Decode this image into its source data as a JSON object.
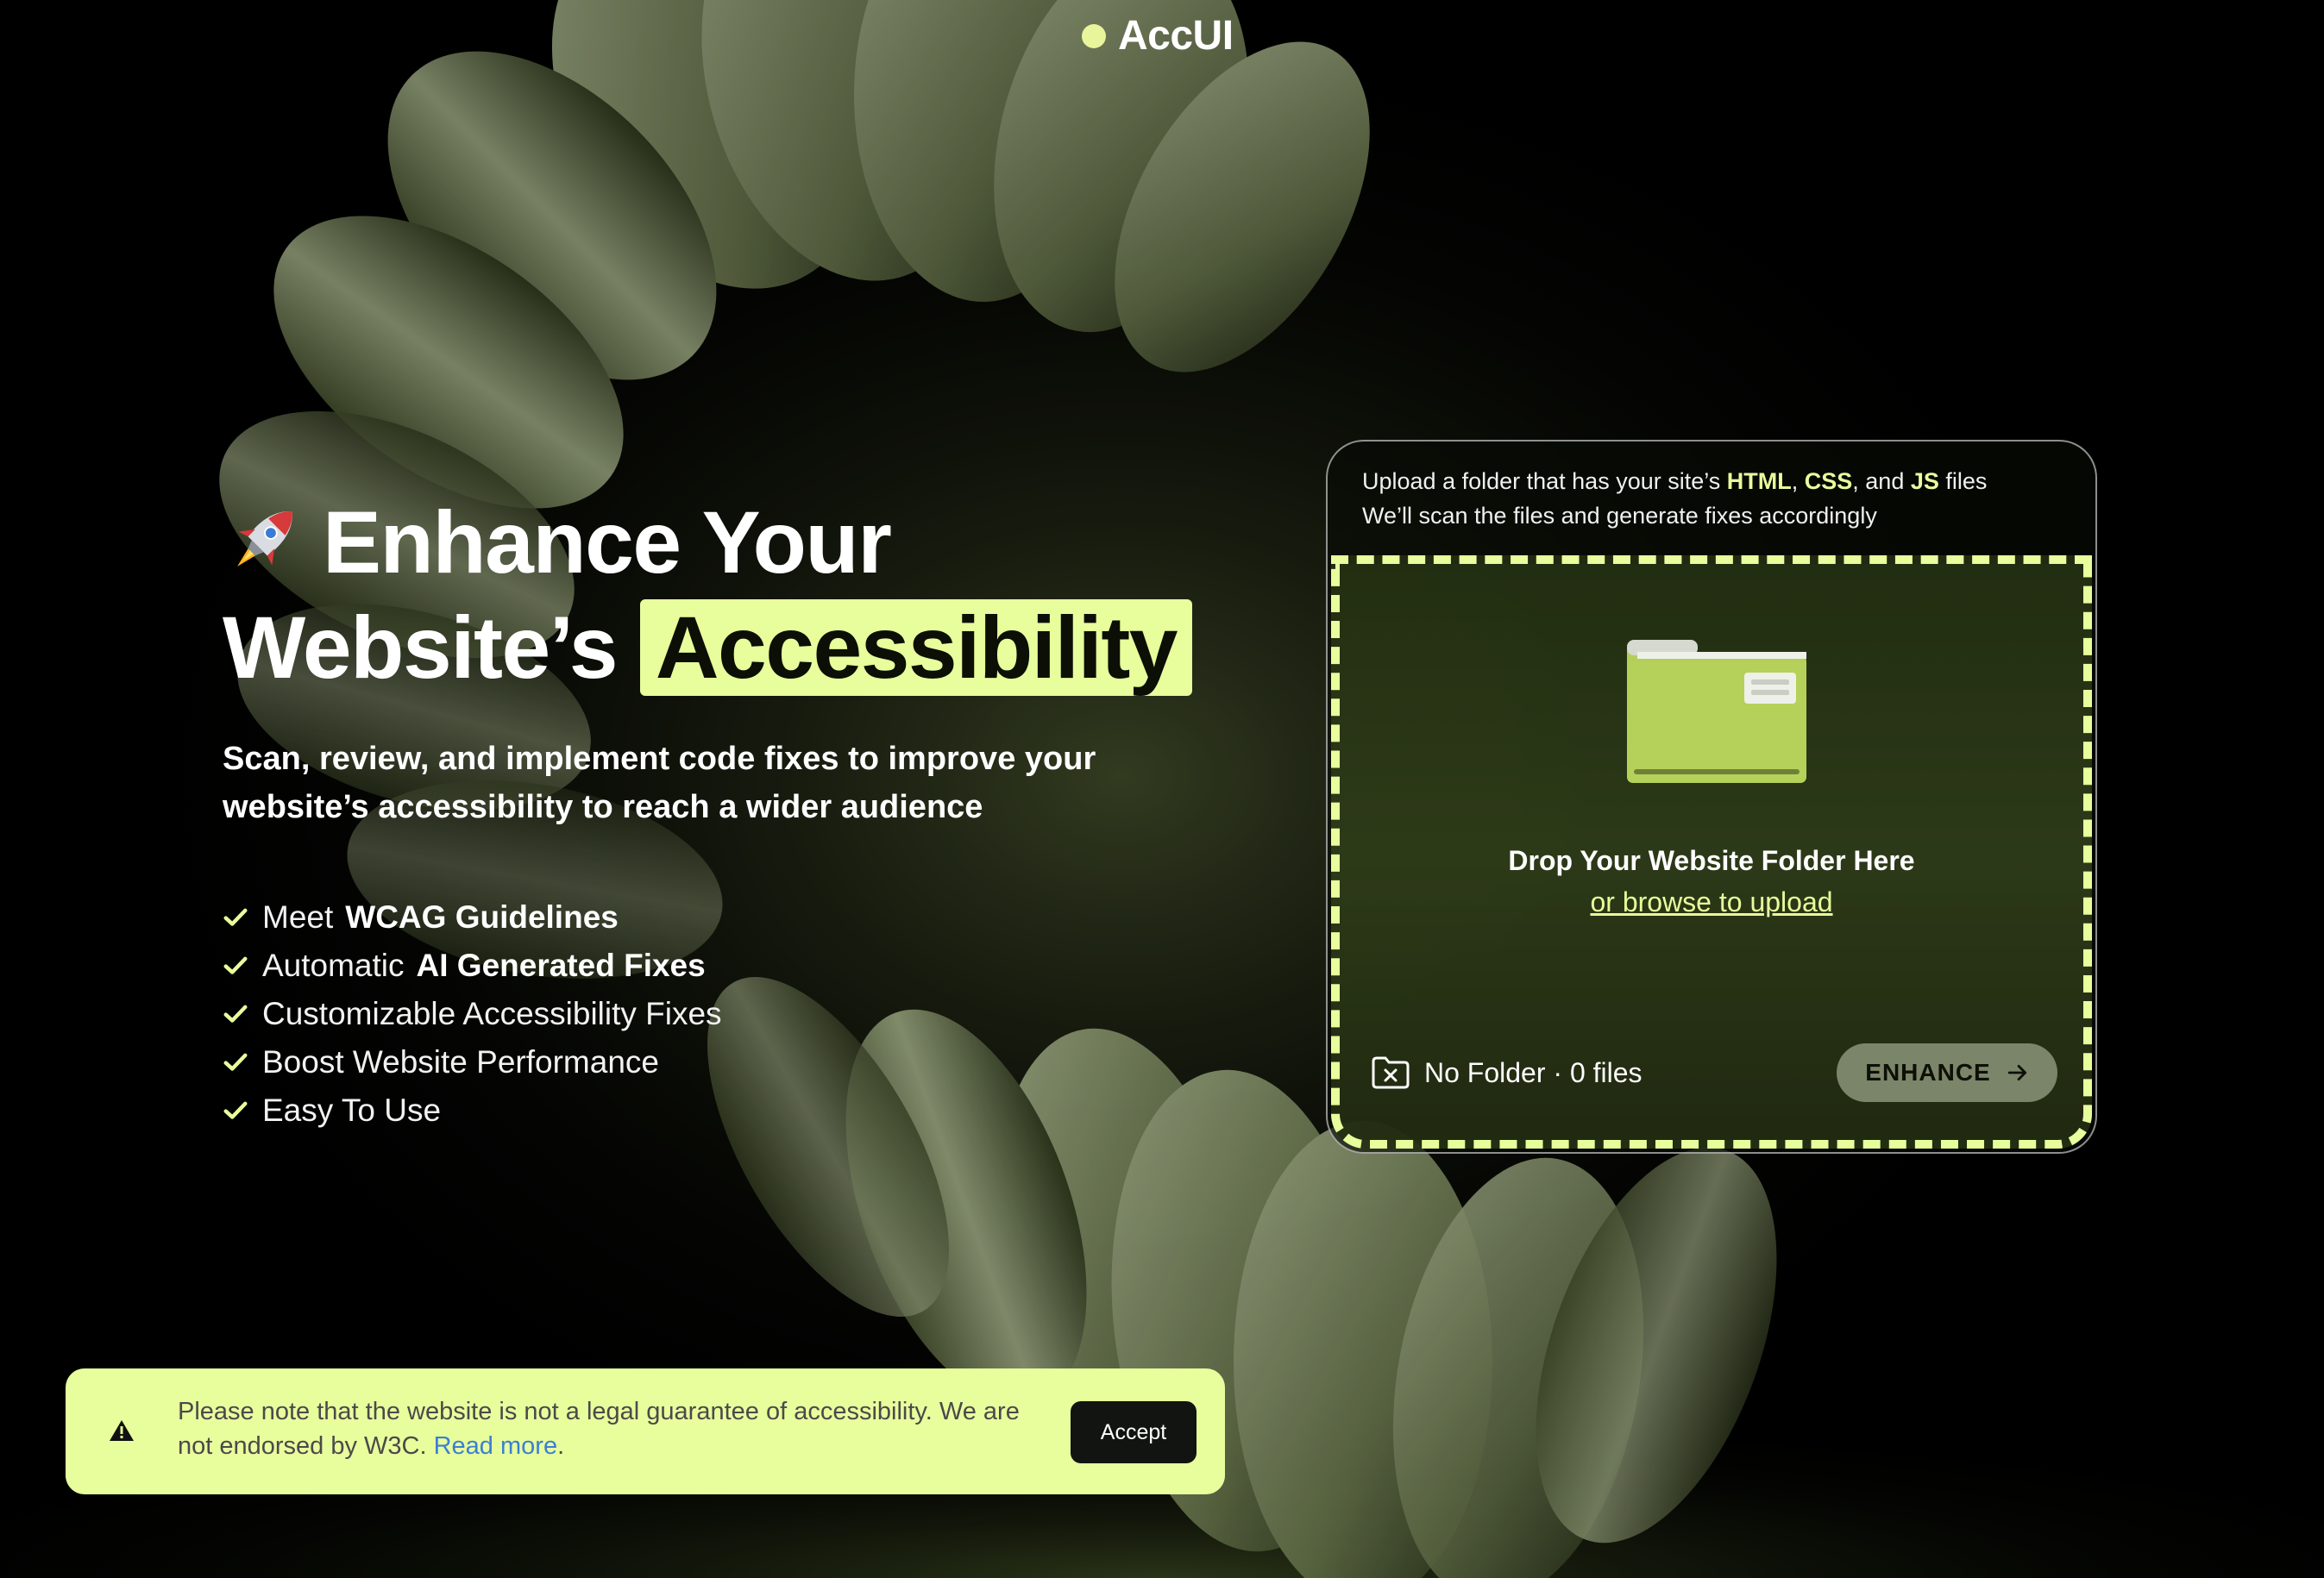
{
  "brand": {
    "name": "AccUI",
    "accent_color": "#e8fd9c"
  },
  "hero": {
    "title_part1": "Enhance Your",
    "title_part2": "Website’s",
    "title_highlight": "Accessibility",
    "subtitle": "Scan, review, and implement code fixes to improve your website’s accessibility to reach a wider audience",
    "rocket_icon": "rocket-emoji"
  },
  "features": [
    {
      "prefix": "Meet",
      "strong": "WCAG Guidelines"
    },
    {
      "prefix": "Automatic",
      "strong": "AI Generated Fixes"
    },
    {
      "prefix": "Customizable Accessibility Fixes",
      "strong": ""
    },
    {
      "prefix": "Boost Website Performance",
      "strong": ""
    },
    {
      "prefix": "Easy To Use",
      "strong": ""
    }
  ],
  "upload": {
    "intro_1": "Upload a folder that has your site’s ",
    "html": "HTML",
    "comma": ", ",
    "css": "CSS",
    "and": ", and ",
    "js": "JS",
    "files": " files",
    "intro_2": "We’ll scan the files and generate fixes accordingly",
    "drop_title": "Drop Your Website Folder Here",
    "browse_label": "or browse to upload",
    "status": "No Folder · 0 files",
    "enhance_label": "ENHANCE"
  },
  "notice": {
    "text": "Please note that the website is not a legal guarantee of accessibility. We are not endorsed by W3C. ",
    "read_more": "Read more",
    "period": ".",
    "accept_label": "Accept"
  }
}
